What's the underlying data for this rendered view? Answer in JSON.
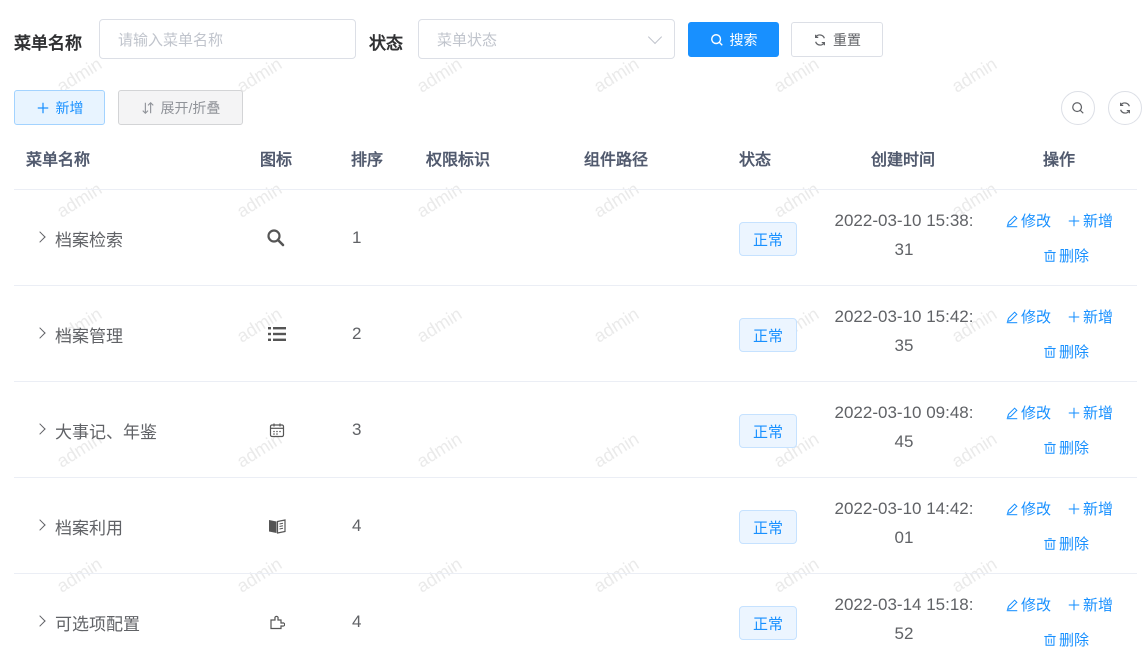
{
  "search": {
    "menu_name_label": "菜单名称",
    "menu_name_placeholder": "请输入菜单名称",
    "status_label": "状态",
    "status_placeholder": "菜单状态",
    "search_button": "搜索",
    "reset_button": "重置"
  },
  "toolbar": {
    "add_button": "新增",
    "toggle_button": "展开/折叠"
  },
  "watermark_text": "admin",
  "table": {
    "headers": [
      "菜单名称",
      "图标",
      "排序",
      "权限标识",
      "组件路径",
      "状态",
      "创建时间",
      "操作"
    ],
    "rows": [
      {
        "name": "档案检索",
        "icon": "search-icon",
        "order": "1",
        "status": "正常",
        "created": "2022-03-10 15:38:31"
      },
      {
        "name": "档案管理",
        "icon": "list-icon",
        "order": "2",
        "status": "正常",
        "created": "2022-03-10 15:42:35"
      },
      {
        "name": "大事记、年鉴",
        "icon": "calendar-icon",
        "order": "3",
        "status": "正常",
        "created": "2022-03-10 09:48:45"
      },
      {
        "name": "档案利用",
        "icon": "book-icon",
        "order": "4",
        "status": "正常",
        "created": "2022-03-10 14:42:01"
      },
      {
        "name": "可选项配置",
        "icon": "puzzle-icon",
        "order": "4",
        "status": "正常",
        "created": "2022-03-14 15:18:52"
      }
    ],
    "actions": {
      "edit": "修改",
      "add": "新增",
      "delete": "删除"
    }
  },
  "colors": {
    "primary": "#1890ff",
    "tag_bg": "#ecf5ff"
  }
}
